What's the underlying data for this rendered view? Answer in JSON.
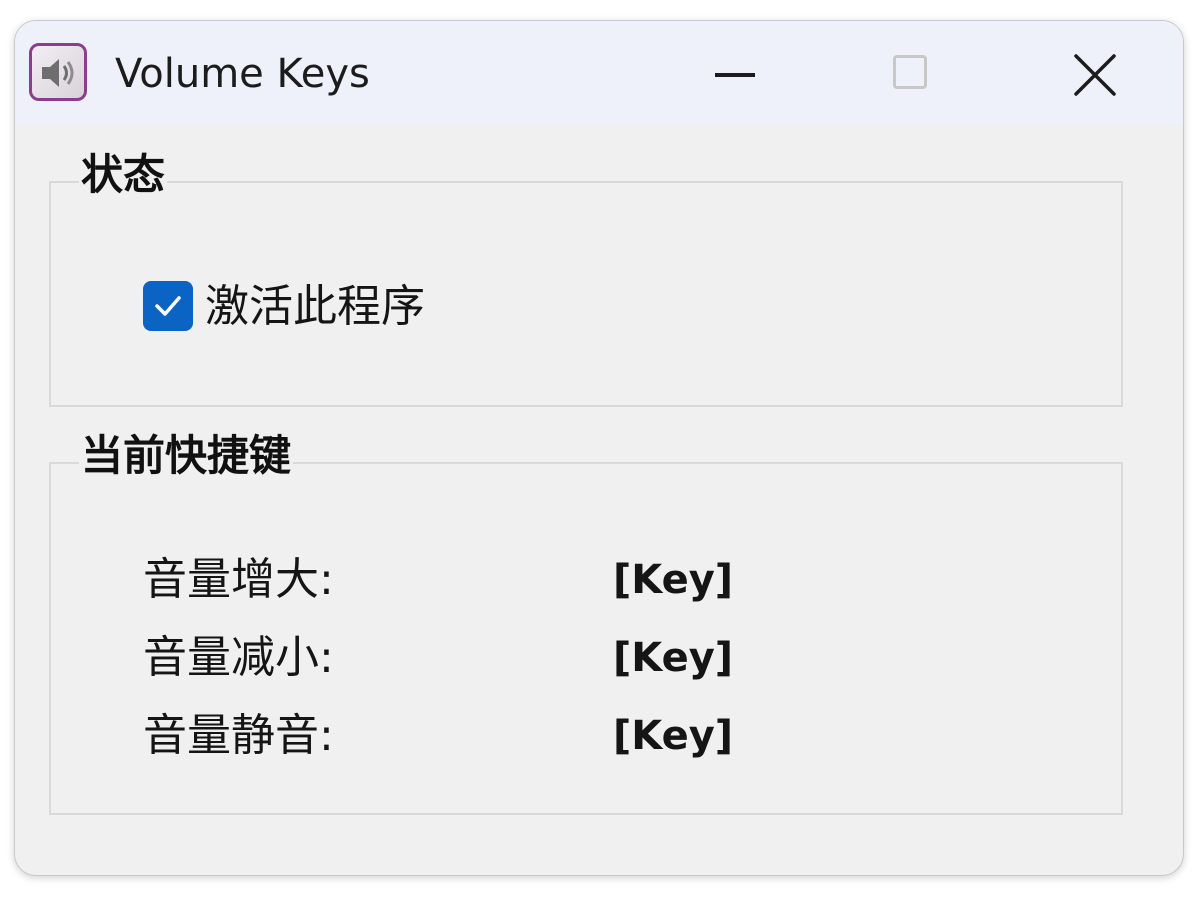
{
  "window": {
    "title": "Volume Keys"
  },
  "status_group": {
    "title": "状态",
    "activate_checkbox": {
      "label": "激活此程序",
      "checked": true
    }
  },
  "hotkeys_group": {
    "title": "当前快捷键",
    "rows": [
      {
        "label": "音量增大:",
        "value": "[Key]"
      },
      {
        "label": "音量减小:",
        "value": "[Key]"
      },
      {
        "label": "音量静音:",
        "value": "[Key]"
      }
    ]
  },
  "icons": {
    "app": "speaker-icon",
    "minimize": "minimize-icon",
    "maximize": "maximize-icon",
    "close": "close-icon",
    "checkbox": "checkmark-icon"
  },
  "colors": {
    "accent": "#0b63c4",
    "titlebar": "#eef1f9",
    "window_bg": "#f0f0f0"
  }
}
